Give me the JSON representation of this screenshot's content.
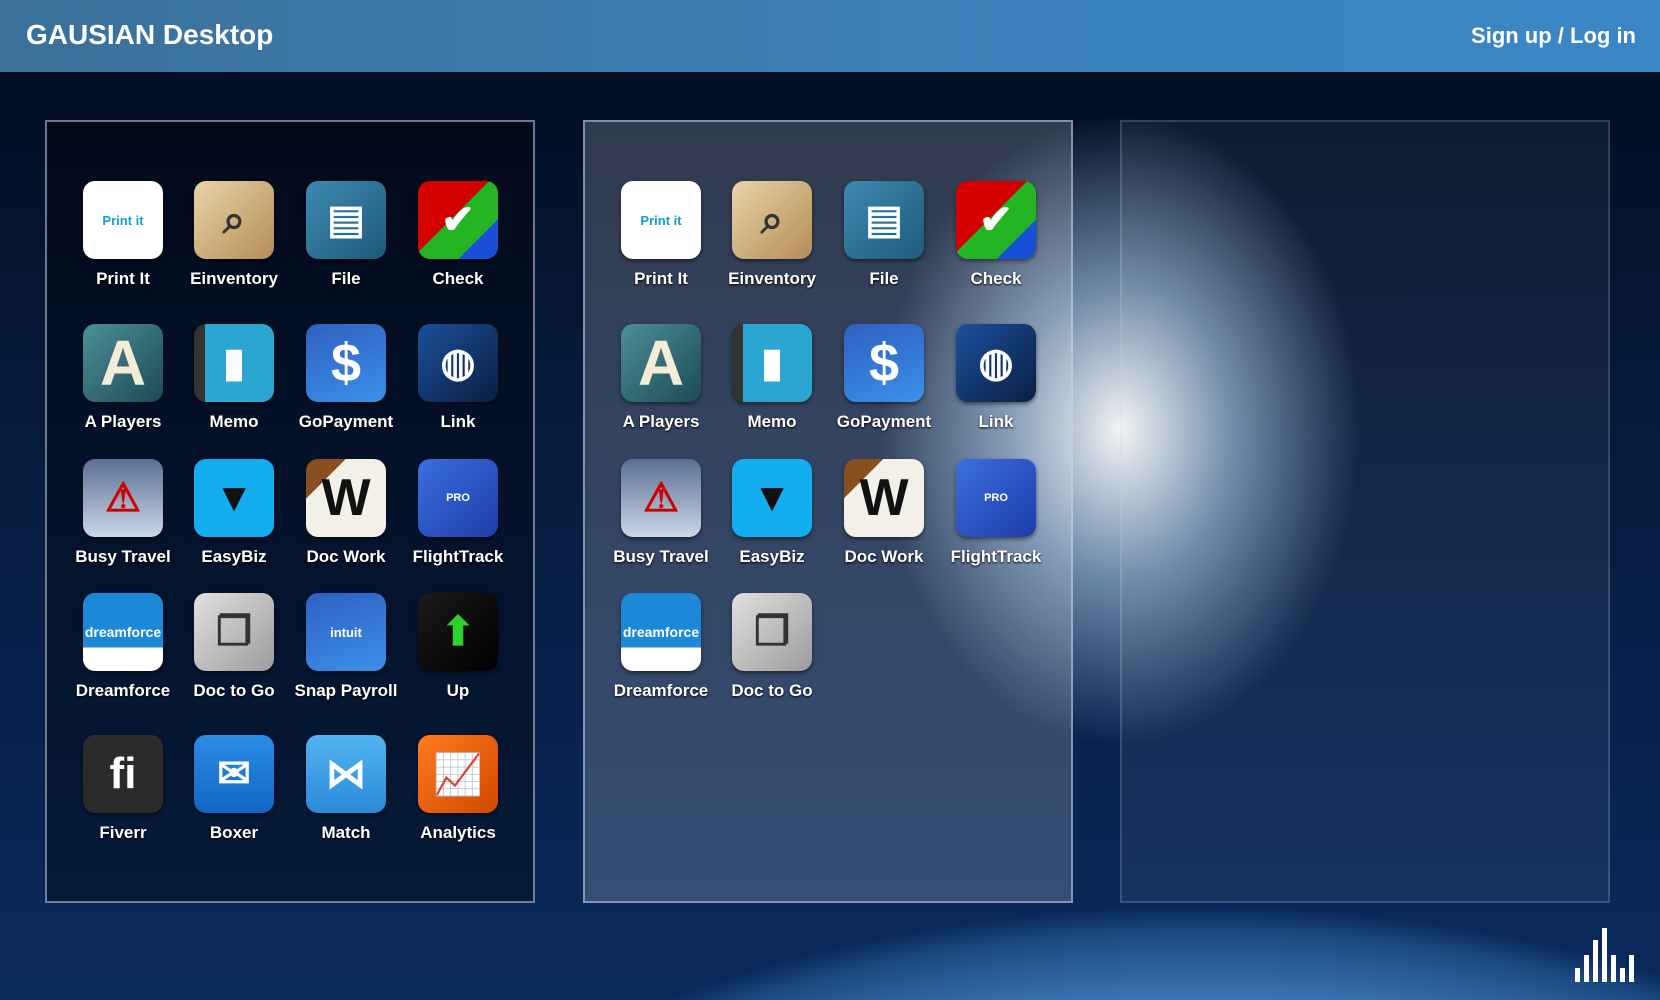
{
  "header": {
    "title": "GAUSIAN Desktop",
    "auth_link": "Sign up / Log in"
  },
  "panels": [
    {
      "apps": [
        {
          "label": "Print It",
          "icon": "print-it-icon",
          "glyph": "Print it"
        },
        {
          "label": "Einventory",
          "icon": "inventory-box-icon"
        },
        {
          "label": "File",
          "icon": "file-folders-icon"
        },
        {
          "label": "Check",
          "icon": "checkmark-icon"
        },
        {
          "label": "A Players",
          "icon": "letter-a-icon",
          "glyph": "A"
        },
        {
          "label": "Memo",
          "icon": "bookmark-book-icon"
        },
        {
          "label": "GoPayment",
          "icon": "intuit-dollar-icon",
          "glyph": "$"
        },
        {
          "label": "Link",
          "icon": "network-globe-icon"
        },
        {
          "label": "Busy Travel",
          "icon": "plane-warning-sign-icon"
        },
        {
          "label": "EasyBiz",
          "icon": "necktie-icon"
        },
        {
          "label": "Doc Work",
          "icon": "notepad-w-icon",
          "glyph": "W"
        },
        {
          "label": "FlightTrack",
          "icon": "airplane-pro-icon",
          "glyph": "PRO"
        },
        {
          "label": "Dreamforce",
          "icon": "dreamforce-cloud-icon",
          "glyph": "dreamforce"
        },
        {
          "label": "Doc to Go",
          "icon": "documents-windows-icon"
        },
        {
          "label": "Snap Payroll",
          "icon": "intuit-lightning-icon",
          "glyph": "intuit"
        },
        {
          "label": "Up",
          "icon": "green-arrow-up-icon"
        },
        {
          "label": "Fiverr",
          "icon": "fiverr-fi-icon",
          "glyph": "fi"
        },
        {
          "label": "Boxer",
          "icon": "envelope-check-icon"
        },
        {
          "label": "Match",
          "icon": "match-bowtie-icon"
        },
        {
          "label": "Analytics",
          "icon": "line-chart-icon"
        }
      ]
    },
    {
      "apps": [
        {
          "label": "Print It",
          "icon": "print-it-icon",
          "glyph": "Print it"
        },
        {
          "label": "Einventory",
          "icon": "inventory-box-icon"
        },
        {
          "label": "File",
          "icon": "file-folders-icon"
        },
        {
          "label": "Check",
          "icon": "checkmark-icon"
        },
        {
          "label": "A Players",
          "icon": "letter-a-icon",
          "glyph": "A"
        },
        {
          "label": "Memo",
          "icon": "bookmark-book-icon"
        },
        {
          "label": "GoPayment",
          "icon": "intuit-dollar-icon",
          "glyph": "$"
        },
        {
          "label": "Link",
          "icon": "network-globe-icon"
        },
        {
          "label": "Busy Travel",
          "icon": "plane-warning-sign-icon"
        },
        {
          "label": "EasyBiz",
          "icon": "necktie-icon"
        },
        {
          "label": "Doc Work",
          "icon": "notepad-w-icon",
          "glyph": "W"
        },
        {
          "label": "FlightTrack",
          "icon": "airplane-pro-icon",
          "glyph": "PRO"
        },
        {
          "label": "Dreamforce",
          "icon": "dreamforce-cloud-icon",
          "glyph": "dreamforce"
        },
        {
          "label": "Doc to Go",
          "icon": "documents-windows-icon"
        }
      ]
    },
    {
      "apps": []
    }
  ]
}
